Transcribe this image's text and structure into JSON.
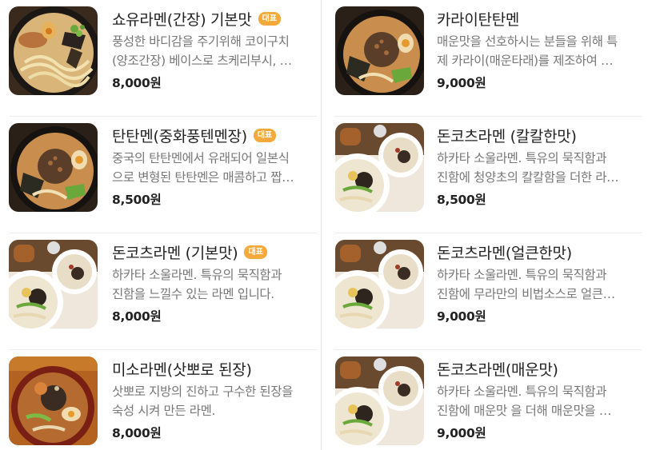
{
  "menu": {
    "left": [
      {
        "name": "쇼유라멘(간장) 기본맛",
        "badge": "대표",
        "desc_line1": "풍성한 바디감을 주기위해 코이구치",
        "desc_line2": "(양조간장) 베이스로 츠케리부시, …",
        "price": "8,000원"
      },
      {
        "name": "탄탄멘(중화풍텐멘장)",
        "badge": "대표",
        "desc_line1": "중국의 탄탄멘에서 유래되어 일본식",
        "desc_line2": "으로 변형된 탄탄멘은 매콤하고 짭…",
        "price": "8,500원"
      },
      {
        "name": "돈코츠라멘 (기본맛)",
        "badge": "대표",
        "desc_line1": "하카타 소울라멘. 특유의 묵직함과",
        "desc_line2": "진함을 느낄수 있는 라멘 입니다.",
        "price": "8,000원"
      },
      {
        "name": "미소라멘(삿뽀로 된장)",
        "badge": "",
        "desc_line1": "삿뽀로 지방의 진하고 구수한 된장을",
        "desc_line2": "숙성 시켜 만든 라멘.",
        "price": "8,000원"
      }
    ],
    "right": [
      {
        "name": "카라이탄탄멘",
        "badge": "",
        "desc_line1": "매운맛을 선호하시는 분들을 위해 특",
        "desc_line2": "제 카라이(매운타래)를 제조하여 …",
        "price": "9,000원"
      },
      {
        "name": "돈코츠라멘 (칼칼한맛)",
        "badge": "",
        "desc_line1": "하카타 소울라멘. 특유의 묵직함과",
        "desc_line2": "진함에 청양초의 칼칼함을 더한 라…",
        "price": "8,500원"
      },
      {
        "name": "돈코츠라멘(얼큰한맛)",
        "badge": "",
        "desc_line1": "하카타 소울라멘. 특유의 묵직함과",
        "desc_line2": "진함에 무라만의 비법소스로 얼큰…",
        "price": "9,000원"
      },
      {
        "name": "돈코츠라멘(매운맛)",
        "badge": "",
        "desc_line1": "하카타 소울라멘. 특유의 묵직함과",
        "desc_line2": "진함에 매운맛 을 더해 매운맛을 …",
        "price": "9,000원"
      }
    ]
  },
  "colors": {
    "badge": "#f4a93b",
    "title": "#222222",
    "description": "#777777",
    "price": "#222222",
    "divider": "#e6e6e6"
  },
  "icons": {
    "thumbnail": "ramen-bowl-photo"
  }
}
